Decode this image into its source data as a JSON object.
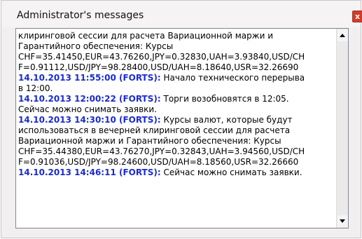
{
  "window": {
    "title": "Administrator's messages",
    "close_label": "x"
  },
  "colors": {
    "timestamp": "#1a2bd0",
    "text": "#000000",
    "window_bg": "#f2eff0",
    "close_button": "#d43b25"
  },
  "icons": {
    "close": "close-icon",
    "scroll_up": "arrow-up-icon",
    "scroll_down": "arrow-down-icon"
  },
  "messages": {
    "lines": [
      {
        "ts": "",
        "text": "клиринговой сессии для расчета Вариационной маржи и"
      },
      {
        "ts": "",
        "text": "Гарантийного обеспечения: Курсы"
      },
      {
        "ts": "",
        "text": "CHF=35.41450,EUR=43.76260,JPY=0.32830,UAH=3.93840,USD/CH"
      },
      {
        "ts": "",
        "text": "F=0.91112,USD/JPY=98.28400,USD/UAH=8.18640,USR=32.26690"
      },
      {
        "ts": "14.10.2013 11:55:00 (FORTS):",
        "text": " Начало технического перерыва"
      },
      {
        "ts": "",
        "text": "в 12:00."
      },
      {
        "ts": "14.10.2013 12:00:22 (FORTS):",
        "text": " Торги возобновятся в 12:05."
      },
      {
        "ts": "",
        "text": "Сейчас можно снимать заявки."
      },
      {
        "ts": "14.10.2013 14:30:10 (FORTS):",
        "text": " Курсы валют, которые будут"
      },
      {
        "ts": "",
        "text": "использоваться в вечерней клиринговой сессии для расчета"
      },
      {
        "ts": "",
        "text": "Вариационной маржи и Гарантийного обеспечения: Курсы"
      },
      {
        "ts": "",
        "text": "CHF=35.44380,EUR=43.76270,JPY=0.32843,UAH=3.94560,USD/CH"
      },
      {
        "ts": "",
        "text": "F=0.91036,USD/JPY=98.24600,USD/UAH=8.18560,USR=32.26660"
      },
      {
        "ts": "14.10.2013 14:46:11 (FORTS):",
        "text": " Сейчас можно снимать заявки."
      }
    ]
  }
}
